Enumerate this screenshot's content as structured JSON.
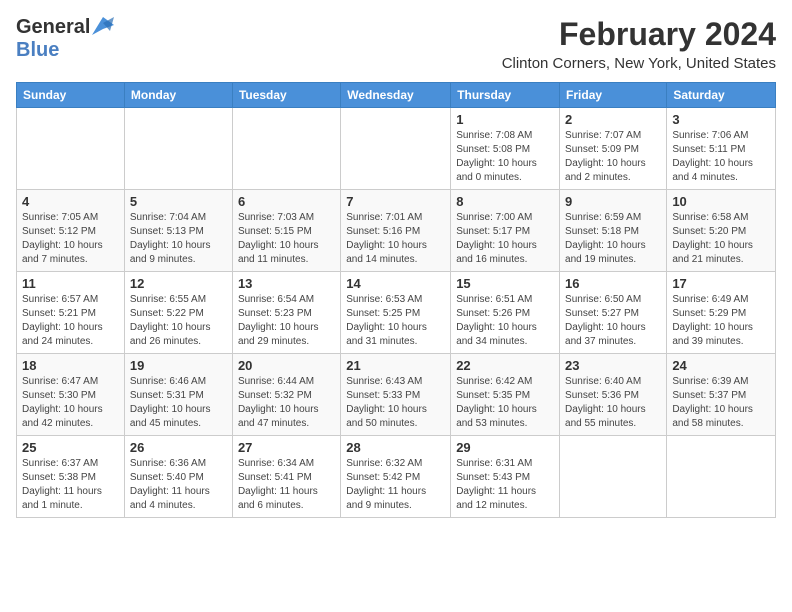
{
  "header": {
    "logo_general": "General",
    "logo_blue": "Blue",
    "month_year": "February 2024",
    "location": "Clinton Corners, New York, United States"
  },
  "weekdays": [
    "Sunday",
    "Monday",
    "Tuesday",
    "Wednesday",
    "Thursday",
    "Friday",
    "Saturday"
  ],
  "weeks": [
    [
      {
        "day": "",
        "info": ""
      },
      {
        "day": "",
        "info": ""
      },
      {
        "day": "",
        "info": ""
      },
      {
        "day": "",
        "info": ""
      },
      {
        "day": "1",
        "info": "Sunrise: 7:08 AM\nSunset: 5:08 PM\nDaylight: 10 hours\nand 0 minutes."
      },
      {
        "day": "2",
        "info": "Sunrise: 7:07 AM\nSunset: 5:09 PM\nDaylight: 10 hours\nand 2 minutes."
      },
      {
        "day": "3",
        "info": "Sunrise: 7:06 AM\nSunset: 5:11 PM\nDaylight: 10 hours\nand 4 minutes."
      }
    ],
    [
      {
        "day": "4",
        "info": "Sunrise: 7:05 AM\nSunset: 5:12 PM\nDaylight: 10 hours\nand 7 minutes."
      },
      {
        "day": "5",
        "info": "Sunrise: 7:04 AM\nSunset: 5:13 PM\nDaylight: 10 hours\nand 9 minutes."
      },
      {
        "day": "6",
        "info": "Sunrise: 7:03 AM\nSunset: 5:15 PM\nDaylight: 10 hours\nand 11 minutes."
      },
      {
        "day": "7",
        "info": "Sunrise: 7:01 AM\nSunset: 5:16 PM\nDaylight: 10 hours\nand 14 minutes."
      },
      {
        "day": "8",
        "info": "Sunrise: 7:00 AM\nSunset: 5:17 PM\nDaylight: 10 hours\nand 16 minutes."
      },
      {
        "day": "9",
        "info": "Sunrise: 6:59 AM\nSunset: 5:18 PM\nDaylight: 10 hours\nand 19 minutes."
      },
      {
        "day": "10",
        "info": "Sunrise: 6:58 AM\nSunset: 5:20 PM\nDaylight: 10 hours\nand 21 minutes."
      }
    ],
    [
      {
        "day": "11",
        "info": "Sunrise: 6:57 AM\nSunset: 5:21 PM\nDaylight: 10 hours\nand 24 minutes."
      },
      {
        "day": "12",
        "info": "Sunrise: 6:55 AM\nSunset: 5:22 PM\nDaylight: 10 hours\nand 26 minutes."
      },
      {
        "day": "13",
        "info": "Sunrise: 6:54 AM\nSunset: 5:23 PM\nDaylight: 10 hours\nand 29 minutes."
      },
      {
        "day": "14",
        "info": "Sunrise: 6:53 AM\nSunset: 5:25 PM\nDaylight: 10 hours\nand 31 minutes."
      },
      {
        "day": "15",
        "info": "Sunrise: 6:51 AM\nSunset: 5:26 PM\nDaylight: 10 hours\nand 34 minutes."
      },
      {
        "day": "16",
        "info": "Sunrise: 6:50 AM\nSunset: 5:27 PM\nDaylight: 10 hours\nand 37 minutes."
      },
      {
        "day": "17",
        "info": "Sunrise: 6:49 AM\nSunset: 5:29 PM\nDaylight: 10 hours\nand 39 minutes."
      }
    ],
    [
      {
        "day": "18",
        "info": "Sunrise: 6:47 AM\nSunset: 5:30 PM\nDaylight: 10 hours\nand 42 minutes."
      },
      {
        "day": "19",
        "info": "Sunrise: 6:46 AM\nSunset: 5:31 PM\nDaylight: 10 hours\nand 45 minutes."
      },
      {
        "day": "20",
        "info": "Sunrise: 6:44 AM\nSunset: 5:32 PM\nDaylight: 10 hours\nand 47 minutes."
      },
      {
        "day": "21",
        "info": "Sunrise: 6:43 AM\nSunset: 5:33 PM\nDaylight: 10 hours\nand 50 minutes."
      },
      {
        "day": "22",
        "info": "Sunrise: 6:42 AM\nSunset: 5:35 PM\nDaylight: 10 hours\nand 53 minutes."
      },
      {
        "day": "23",
        "info": "Sunrise: 6:40 AM\nSunset: 5:36 PM\nDaylight: 10 hours\nand 55 minutes."
      },
      {
        "day": "24",
        "info": "Sunrise: 6:39 AM\nSunset: 5:37 PM\nDaylight: 10 hours\nand 58 minutes."
      }
    ],
    [
      {
        "day": "25",
        "info": "Sunrise: 6:37 AM\nSunset: 5:38 PM\nDaylight: 11 hours\nand 1 minute."
      },
      {
        "day": "26",
        "info": "Sunrise: 6:36 AM\nSunset: 5:40 PM\nDaylight: 11 hours\nand 4 minutes."
      },
      {
        "day": "27",
        "info": "Sunrise: 6:34 AM\nSunset: 5:41 PM\nDaylight: 11 hours\nand 6 minutes."
      },
      {
        "day": "28",
        "info": "Sunrise: 6:32 AM\nSunset: 5:42 PM\nDaylight: 11 hours\nand 9 minutes."
      },
      {
        "day": "29",
        "info": "Sunrise: 6:31 AM\nSunset: 5:43 PM\nDaylight: 11 hours\nand 12 minutes."
      },
      {
        "day": "",
        "info": ""
      },
      {
        "day": "",
        "info": ""
      }
    ]
  ]
}
